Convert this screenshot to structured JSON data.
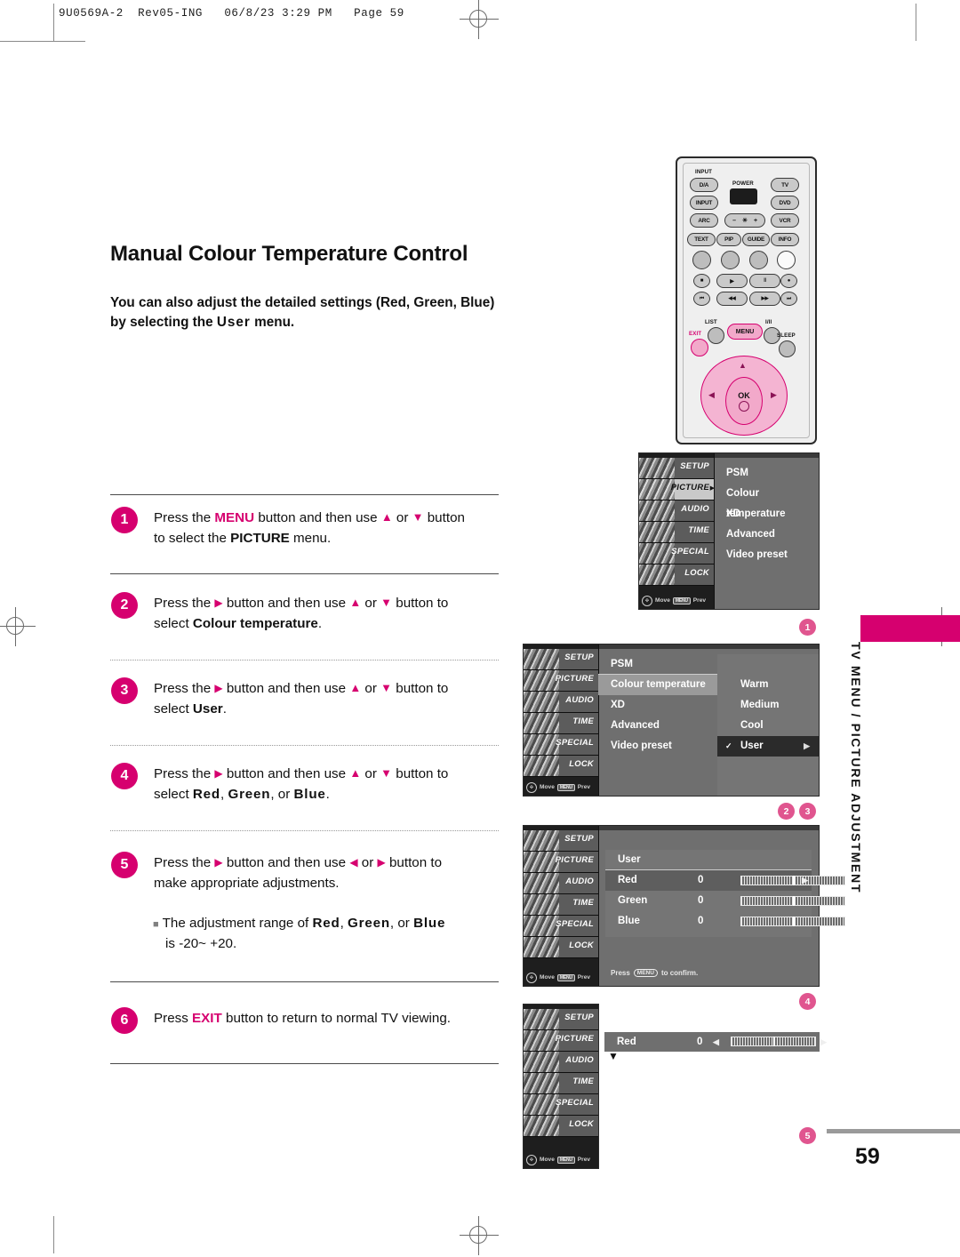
{
  "header": {
    "slug": "9U0569A-2  Rev05-ING   06/8/23 3:29 PM   Page 59"
  },
  "page": {
    "title": "Manual Colour Temperature Control",
    "intro_line1": "You can also adjust the detailed settings (Red, Green, Blue)",
    "intro_line2_a": "by selecting the ",
    "intro_line2_b": "User",
    "intro_line2_c": " menu.",
    "number": "59",
    "side_tab": "TV MENU / PICTURE ADJUSTMENT"
  },
  "steps": [
    {
      "num": "1",
      "l1_a": "Press the ",
      "l1_key": "MENU",
      "l1_b": " button and then use ",
      "l1_up": "▲",
      "l1_c": " or ",
      "l1_dn": "▼",
      "l1_d": " button",
      "l2_a": "to select the ",
      "l2_b": "PICTURE",
      "l2_c": " menu."
    },
    {
      "num": "2",
      "l1_a": "Press the ",
      "l1_key": "▶",
      "l1_b": " button and then use ",
      "l1_up": "▲",
      "l1_c": " or ",
      "l1_dn": "▼",
      "l1_d": " button to",
      "l2_a": "select ",
      "l2_b": "Colour temperature",
      "l2_c": "."
    },
    {
      "num": "3",
      "l1_a": "Press the ",
      "l1_key": "▶",
      "l1_b": " button and then use ",
      "l1_up": "▲",
      "l1_c": " or ",
      "l1_dn": "▼",
      "l1_d": " button to",
      "l2_a": "select ",
      "l2_b": "User",
      "l2_c": "."
    },
    {
      "num": "4",
      "l1_a": "Press the ",
      "l1_key": "▶",
      "l1_b": " button and then use ",
      "l1_up": "▲",
      "l1_c": " or ",
      "l1_dn": "▼",
      "l1_d": " button to",
      "l2_a": "select ",
      "l2_b": "Red",
      "l2_c": ", ",
      "l2_d": "Green",
      "l2_e": ", or ",
      "l2_f": "Blue",
      "l2_g": "."
    },
    {
      "num": "5",
      "l1_a": "Press the ",
      "l1_key": "▶",
      "l1_b": " button and then use ",
      "l1_up": "◀",
      "l1_c": " or ",
      "l1_dn": "▶",
      "l1_d": " button to",
      "l2_a": "make appropriate adjustments."
    },
    {
      "num": "6",
      "l1_a": "Press ",
      "l1_key": "EXIT",
      "l1_b": " button to return to normal TV viewing."
    }
  ],
  "note": {
    "bullet": "■",
    "a": "The adjustment range of ",
    "red": "Red",
    "b": ", ",
    "green": "Green",
    "c": ", or ",
    "blue": "Blue",
    "d": "is -20~ +20."
  },
  "remote": {
    "input_label": "INPUT",
    "power_label": "POWER",
    "buttons": {
      "da": "D/A",
      "tv": "TV",
      "input": "INPUT",
      "dvd": "DVD",
      "arc": "ARC",
      "vcr": "VCR",
      "bright_minus": "–",
      "bright_icon": "☀",
      "bright_plus": "+",
      "text": "TEXT",
      "pip": "PIP",
      "guide": "GUIDE",
      "info": "INFO",
      "stop": "■",
      "play": "▶",
      "pause": "‖",
      "record": "●",
      "prev": "⏮",
      "rew": "◀◀",
      "ff": "▶▶",
      "next": "⏭",
      "list": "LIST",
      "menu": "MENU",
      "iii": "I/II",
      "exit": "EXIT",
      "sleep": "SLEEP",
      "ok": "OK",
      "up": "▲",
      "down": "▼",
      "left": "◀",
      "right": "▶"
    }
  },
  "osd": {
    "sidebar": [
      "SETUP",
      "PICTURE",
      "AUDIO",
      "TIME",
      "SPECIAL",
      "LOCK"
    ],
    "footer": {
      "move": "Move",
      "menu_key": "MENU",
      "prev": "Prev"
    },
    "menu1": {
      "active_sidebar": "PICTURE",
      "items": [
        "PSM",
        "Colour temperature",
        "XD",
        "Advanced",
        "Video preset"
      ]
    },
    "menu2": {
      "items": [
        "PSM",
        "Colour temperature",
        "XD",
        "Advanced",
        "Video preset"
      ],
      "selected": "Colour temperature",
      "options": [
        "Warm",
        "Medium",
        "Cool",
        "User"
      ],
      "selected_option": "User",
      "check": "✓",
      "arrow": "▶"
    },
    "menu3": {
      "heading": "User",
      "rows": [
        {
          "name": "Red",
          "value": "0"
        },
        {
          "name": "Green",
          "value": "0"
        },
        {
          "name": "Blue",
          "value": "0"
        }
      ],
      "confirm_a": "Press",
      "confirm_key": "MENU",
      "confirm_b": "to confirm.",
      "arrow": "▶"
    },
    "menu4": {
      "row": {
        "name": "Red",
        "value": "0"
      },
      "left_arrow": "◀",
      "right_arrow": "▶",
      "down_arrow": "▼"
    }
  },
  "markers": [
    "1",
    "2",
    "3",
    "4",
    "5"
  ],
  "colors": {
    "accent": "#d6006f",
    "marker": "#e0558f",
    "osd_bg": "#6f6f6f",
    "osd_dark": "#1e1e1e"
  }
}
